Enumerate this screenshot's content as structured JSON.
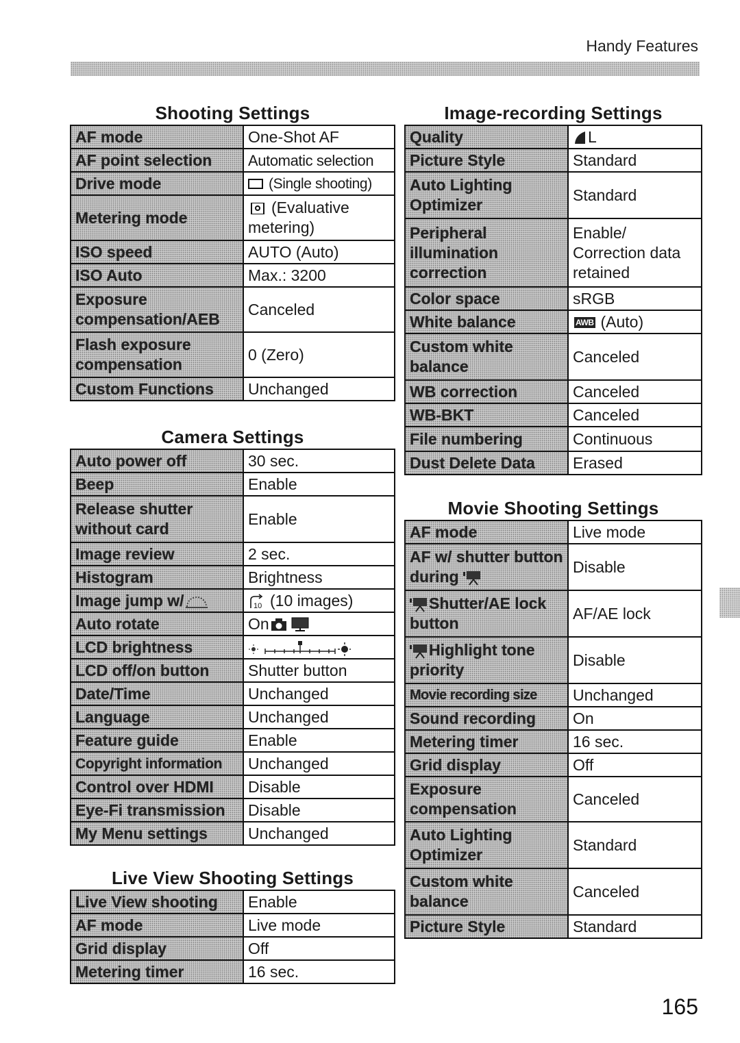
{
  "header": {
    "section_title": "Handy Features"
  },
  "page_number": "165",
  "tables": {
    "shooting": {
      "title": "Shooting Settings",
      "rows": [
        {
          "setting": "AF mode",
          "value": "One-Shot AF"
        },
        {
          "setting": "AF point selection",
          "value": "Automatic selection"
        },
        {
          "setting": "Drive mode",
          "value": "(Single shooting)",
          "icon": "single-shooting-icon"
        },
        {
          "setting": "Metering mode",
          "value": "(Evaluative metering)",
          "icon": "evaluative-metering-icon"
        },
        {
          "setting": "ISO speed",
          "value": "AUTO (Auto)"
        },
        {
          "setting": "ISO Auto",
          "value": "Max.: 3200"
        },
        {
          "setting": "Exposure compensation/AEB",
          "value": "Canceled"
        },
        {
          "setting": "Flash exposure compensation",
          "value": "0 (Zero)"
        },
        {
          "setting": "Custom Functions",
          "value": "Unchanged"
        }
      ]
    },
    "camera": {
      "title": "Camera Settings",
      "rows": [
        {
          "setting": "Auto power off",
          "value": "30 sec."
        },
        {
          "setting": "Beep",
          "value": "Enable"
        },
        {
          "setting": "Release shutter without card",
          "value": "Enable"
        },
        {
          "setting": "Image review",
          "value": "2 sec."
        },
        {
          "setting": "Histogram",
          "value": "Brightness"
        },
        {
          "setting": "Image jump w/",
          "setting_icon": "main-dial-icon",
          "value": "(10 images)",
          "icon": "jump-10-icon"
        },
        {
          "setting": "Auto rotate",
          "value": "On",
          "icon": "camera-and-monitor-icons"
        },
        {
          "setting": "LCD brightness",
          "value": "",
          "icon": "brightness-scale-icon",
          "level_fraction": 0.5
        },
        {
          "setting": "LCD off/on button",
          "value": "Shutter button"
        },
        {
          "setting": "Date/Time",
          "value": "Unchanged"
        },
        {
          "setting": "Language",
          "value": "Unchanged"
        },
        {
          "setting": "Feature guide",
          "value": "Enable"
        },
        {
          "setting": "Copyright information",
          "value": "Unchanged"
        },
        {
          "setting": "Control over HDMI",
          "value": "Disable"
        },
        {
          "setting": "Eye-Fi transmission",
          "value": "Disable"
        },
        {
          "setting": "My Menu settings",
          "value": "Unchanged"
        }
      ]
    },
    "liveview": {
      "title": "Live View Shooting Settings",
      "rows": [
        {
          "setting": "Live View shooting",
          "value": "Enable"
        },
        {
          "setting": "AF mode",
          "value": "Live mode"
        },
        {
          "setting": "Grid display",
          "value": "Off"
        },
        {
          "setting": "Metering timer",
          "value": "16 sec."
        }
      ]
    },
    "imagerec": {
      "title": "Image-recording Settings",
      "rows": [
        {
          "setting": "Quality",
          "value": "L",
          "icon": "fine-quality-icon"
        },
        {
          "setting": "Picture Style",
          "value": "Standard"
        },
        {
          "setting": "Auto Lighting Optimizer",
          "value": "Standard"
        },
        {
          "setting": "Peripheral illumination correction",
          "value": "Enable/ Correction data retained"
        },
        {
          "setting": "Color space",
          "value": "sRGB"
        },
        {
          "setting": "White balance",
          "value": "(Auto)",
          "icon": "awb-icon",
          "icon_text": "AWB"
        },
        {
          "setting": "Custom white balance",
          "value": "Canceled"
        },
        {
          "setting": "WB correction",
          "value": "Canceled"
        },
        {
          "setting": "WB-BKT",
          "value": "Canceled"
        },
        {
          "setting": "File numbering",
          "value": "Continuous"
        },
        {
          "setting": "Dust Delete Data",
          "value": "Erased"
        }
      ]
    },
    "movie": {
      "title": "Movie Shooting Settings",
      "rows": [
        {
          "setting": "AF mode",
          "value": "Live mode"
        },
        {
          "setting": "AF w/ shutter button during",
          "setting_icon": "movie-camera-icon",
          "value": "Disable"
        },
        {
          "setting": "Shutter/AE lock button",
          "setting_icon": "movie-camera-icon",
          "value": "AF/AE lock"
        },
        {
          "setting": "Highlight tone priority",
          "setting_icon": "movie-camera-icon",
          "value": "Disable"
        },
        {
          "setting": "Movie recording size",
          "value": "Unchanged"
        },
        {
          "setting": "Sound recording",
          "value": "On"
        },
        {
          "setting": "Metering timer",
          "value": "16 sec."
        },
        {
          "setting": "Grid display",
          "value": "Off"
        },
        {
          "setting": "Exposure compensation",
          "value": "Canceled"
        },
        {
          "setting": "Auto Lighting Optimizer",
          "value": "Standard"
        },
        {
          "setting": "Custom white balance",
          "value": "Canceled"
        },
        {
          "setting": "Picture Style",
          "value": "Standard"
        }
      ]
    }
  }
}
